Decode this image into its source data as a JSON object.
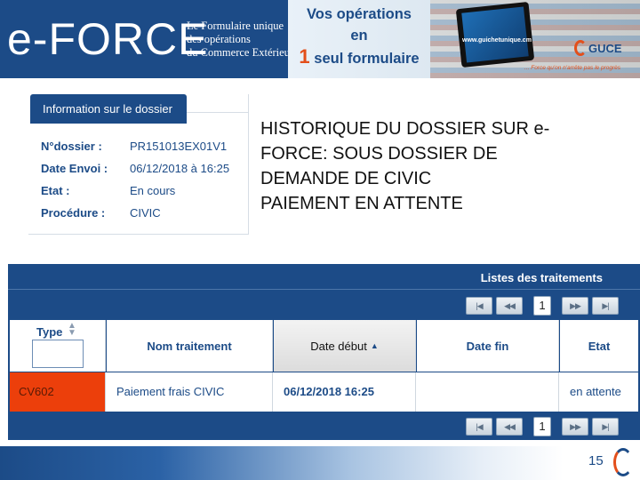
{
  "banner": {
    "brand": "e-FORCE",
    "tagline": [
      "Le Formulaire unique",
      "des opérations",
      "du Commerce Extérieur"
    ],
    "promo_line1": "Vos opérations",
    "promo_line2": "en",
    "promo_number": "1",
    "promo_line3": "seul formulaire",
    "site_url": "www.guichetunique.cm",
    "guce_label": "GUCE",
    "guce_motto": "... Force qu'on n'arrête pas le progrès"
  },
  "info": {
    "header": "Information sur le dossier",
    "rows": [
      {
        "label": "N°dossier :",
        "value": "PR151013EX01V1"
      },
      {
        "label": "Date Envoi :",
        "value": "06/12/2018 à 16:25"
      },
      {
        "label": "Etat :",
        "value": "En cours"
      },
      {
        "label": "Procédure :",
        "value": "CIVIC"
      }
    ]
  },
  "heading": {
    "line1": "HISTORIQUE DU DOSSIER SUR e-",
    "line2": "FORCE: SOUS DOSSIER DE",
    "line3": "DEMANDE DE CIVIC",
    "line4": "PAIEMENT EN ATTENTE"
  },
  "table": {
    "title": "Listes des traitements",
    "current_page": "1",
    "columns": {
      "type": "Type",
      "nom": "Nom traitement",
      "date_debut": "Date début",
      "date_fin": "Date fin",
      "etat": "Etat"
    },
    "rows": [
      {
        "type": "CV602",
        "nom": "Paiement frais CIVIC",
        "date_debut": "06/12/2018 16:25",
        "date_fin": "",
        "etat": "en attente"
      }
    ]
  },
  "footer": {
    "page_number": "15"
  },
  "colors": {
    "brand_blue": "#1c4b87",
    "accent_orange": "#ec3f0b"
  }
}
